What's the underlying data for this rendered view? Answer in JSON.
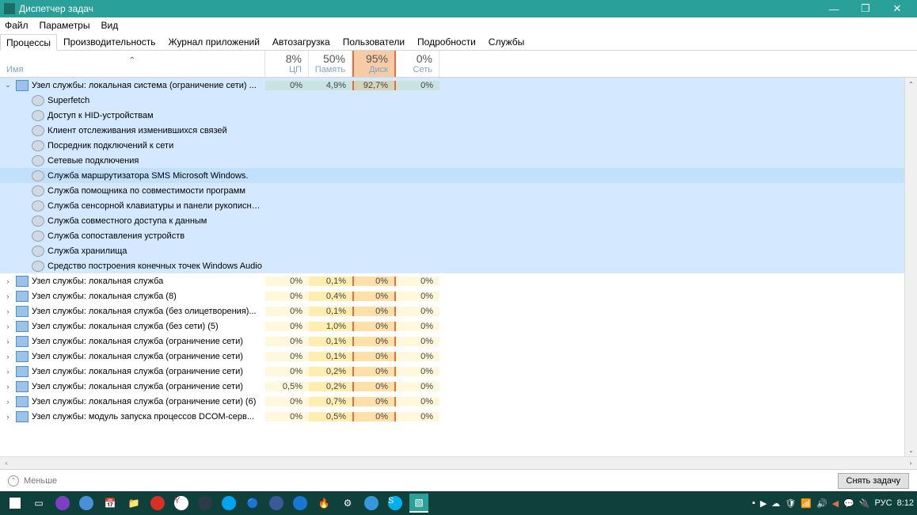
{
  "title": "Диспетчер задач",
  "menus": [
    "Файл",
    "Параметры",
    "Вид"
  ],
  "tabs": [
    "Процессы",
    "Производительность",
    "Журнал приложений",
    "Автозагрузка",
    "Пользователи",
    "Подробности",
    "Службы"
  ],
  "headers": {
    "name": "Имя",
    "cols": [
      {
        "pct": "8%",
        "lbl": "ЦП"
      },
      {
        "pct": "50%",
        "lbl": "Память"
      },
      {
        "pct": "95%",
        "lbl": "Диск",
        "hot": true
      },
      {
        "pct": "0%",
        "lbl": "Сеть"
      }
    ]
  },
  "parent_row": {
    "name": "Узел службы: локальная система (ограничение сети) ...",
    "cpu": "0%",
    "mem": "4,9%",
    "disk": "92,7%",
    "net": "0%"
  },
  "children": [
    "Superfetch",
    "Доступ к HID-устройствам",
    "Клиент отслеживания изменившихся связей",
    "Посредник подключений к сети",
    "Сетевые подключения",
    "Служба маршрутизатора SMS Microsoft Windows.",
    "Служба помощника по совместимости программ",
    "Служба сенсорной клавиатуры и панели рукописно...",
    "Служба совместного доступа к данным",
    "Служба сопоставления устройств",
    "Служба хранилища",
    "Средство построения конечных точек Windows Audio"
  ],
  "highlighted_child_index": 5,
  "other_rows": [
    {
      "name": "Узел службы: локальная служба",
      "cpu": "0%",
      "mem": "0,1%",
      "disk": "0%",
      "net": "0%"
    },
    {
      "name": "Узел службы: локальная служба (8)",
      "cpu": "0%",
      "mem": "0,4%",
      "disk": "0%",
      "net": "0%"
    },
    {
      "name": "Узел службы: локальная служба (без олицетворения)...",
      "cpu": "0%",
      "mem": "0,1%",
      "disk": "0%",
      "net": "0%"
    },
    {
      "name": "Узел службы: локальная служба (без сети) (5)",
      "cpu": "0%",
      "mem": "1,0%",
      "disk": "0%",
      "net": "0%"
    },
    {
      "name": "Узел службы: локальная служба (ограничение сети)",
      "cpu": "0%",
      "mem": "0,1%",
      "disk": "0%",
      "net": "0%"
    },
    {
      "name": "Узел службы: локальная служба (ограничение сети)",
      "cpu": "0%",
      "mem": "0,1%",
      "disk": "0%",
      "net": "0%"
    },
    {
      "name": "Узел службы: локальная служба (ограничение сети)",
      "cpu": "0%",
      "mem": "0,2%",
      "disk": "0%",
      "net": "0%"
    },
    {
      "name": "Узел службы: локальная служба (ограничение сети)",
      "cpu": "0,5%",
      "mem": "0,2%",
      "disk": "0%",
      "net": "0%"
    },
    {
      "name": "Узел службы: локальная служба (ограничение сети) (6)",
      "cpu": "0%",
      "mem": "0,7%",
      "disk": "0%",
      "net": "0%"
    },
    {
      "name": "Узел службы: модуль запуска процессов DCOM-серв...",
      "cpu": "0%",
      "mem": "0,5%",
      "disk": "0%",
      "net": "0%"
    }
  ],
  "footer": {
    "less": "Меньше",
    "end_task": "Снять задачу"
  },
  "tray": {
    "lang": "РУС",
    "time": "8:12"
  }
}
